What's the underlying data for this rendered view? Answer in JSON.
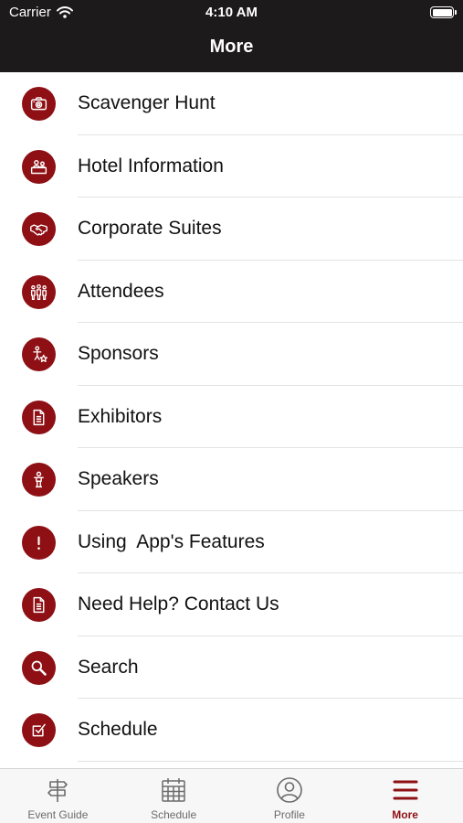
{
  "status_bar": {
    "carrier": "Carrier",
    "time": "4:10 AM"
  },
  "nav": {
    "title": "More"
  },
  "accent_color": "#8e1015",
  "menu": [
    {
      "label": "Scavenger Hunt",
      "icon": "camera-icon"
    },
    {
      "label": "Hotel Information",
      "icon": "front-desk-icon"
    },
    {
      "label": "Corporate Suites",
      "icon": "handshake-icon"
    },
    {
      "label": "Attendees",
      "icon": "people-icon"
    },
    {
      "label": "Sponsors",
      "icon": "sponsor-icon"
    },
    {
      "label": "Exhibitors",
      "icon": "document-icon"
    },
    {
      "label": "Speakers",
      "icon": "speaker-icon"
    },
    {
      "label": "Using  App's Features",
      "icon": "exclamation-icon"
    },
    {
      "label": "Need Help? Contact Us",
      "icon": "document-icon"
    },
    {
      "label": "Search",
      "icon": "search-icon"
    },
    {
      "label": "Schedule",
      "icon": "checkbox-icon"
    }
  ],
  "tabs": [
    {
      "label": "Event Guide",
      "icon": "signpost-icon",
      "active": false
    },
    {
      "label": "Schedule",
      "icon": "calendar-icon",
      "active": false
    },
    {
      "label": "Profile",
      "icon": "profile-icon",
      "active": false
    },
    {
      "label": "More",
      "icon": "hamburger-icon",
      "active": true
    }
  ]
}
